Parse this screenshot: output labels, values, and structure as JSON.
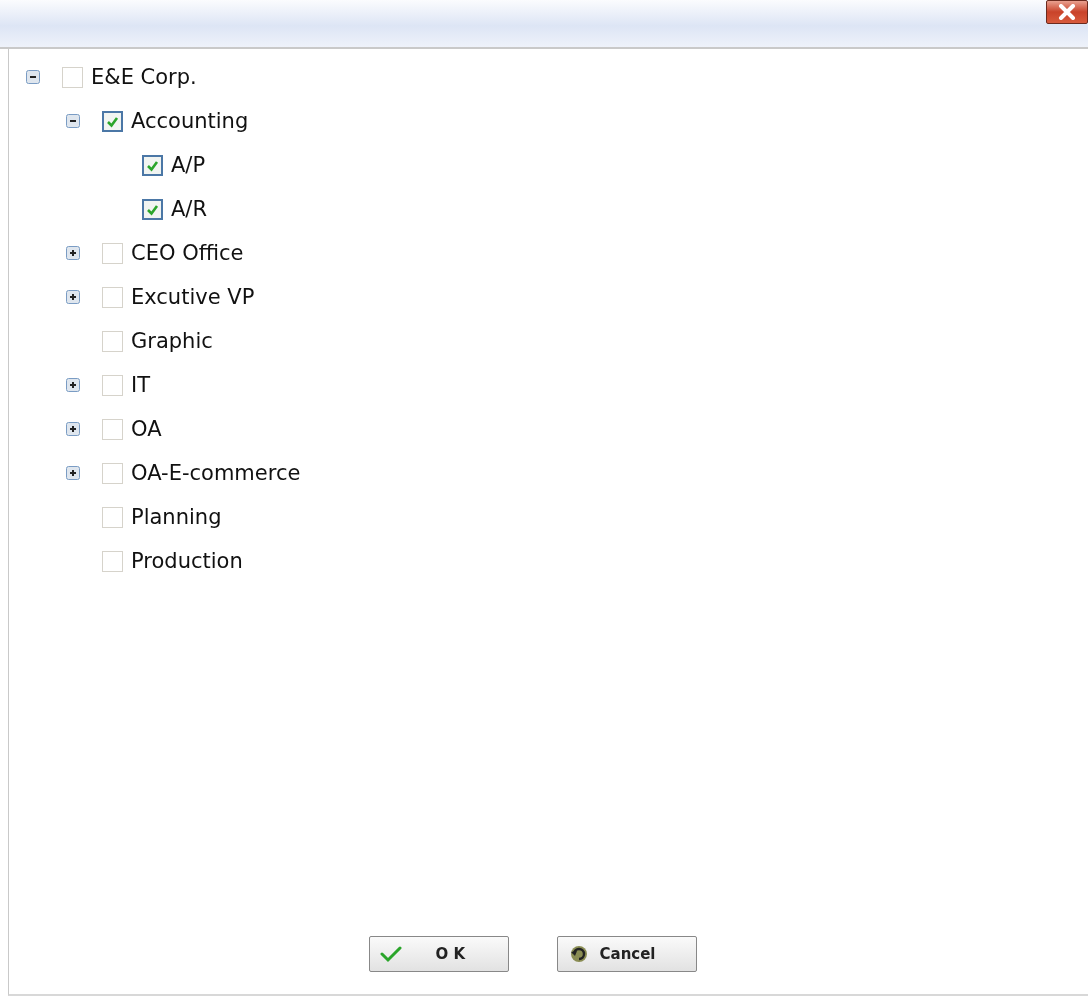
{
  "tree": [
    {
      "label": "E&E Corp.",
      "checked": false,
      "expanded": true,
      "children": [
        {
          "label": "Accounting",
          "checked": true,
          "expanded": true,
          "children": [
            {
              "label": "A/P",
              "checked": true
            },
            {
              "label": "A/R",
              "checked": true
            }
          ]
        },
        {
          "label": "CEO Office",
          "checked": false,
          "expanded": false
        },
        {
          "label": "Excutive VP",
          "checked": false,
          "expanded": false
        },
        {
          "label": "Graphic",
          "checked": false
        },
        {
          "label": "IT",
          "checked": false,
          "expanded": false
        },
        {
          "label": "OA",
          "checked": false,
          "expanded": false
        },
        {
          "label": "OA-E-commerce",
          "checked": false,
          "expanded": false
        },
        {
          "label": "Planning",
          "checked": false
        },
        {
          "label": "Production",
          "checked": false
        }
      ]
    }
  ],
  "buttons": [
    {
      "label": "O K",
      "kind": "ok"
    },
    {
      "label": "Cancel",
      "kind": "cancel"
    }
  ]
}
